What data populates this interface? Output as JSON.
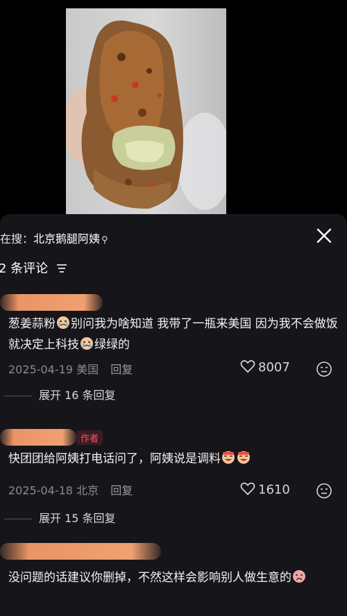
{
  "search": {
    "prefix": "在搜：",
    "keyword": "北京鹅腿阿姨"
  },
  "header": {
    "count_label": "2 条评论"
  },
  "comments": [
    {
      "text_a": "葱姜蒜粉",
      "text_b": "别问我为啥知道 我带了一瓶来美国 因为我不会做饭 就决定上科技",
      "text_c": "绿绿的",
      "date": "2025-04-19",
      "location": "美国",
      "reply_label": "回复",
      "likes": "8007",
      "expand_label": "展开 16 条回复"
    },
    {
      "author_badge": "作者",
      "text_a": "快团团给阿姨打电话问了，阿姨说是调料",
      "date": "2025-04-18",
      "location": "北京",
      "reply_label": "回复",
      "likes": "1610",
      "expand_label": "展开 15 条回复"
    },
    {
      "text_a": "没问题的话建议你删掉，不然这样会影响别人做生意的"
    }
  ],
  "colors": {
    "redaction": "#e99566",
    "author_badge": "#ff4d6a",
    "sheet_bg": "#16161a"
  }
}
